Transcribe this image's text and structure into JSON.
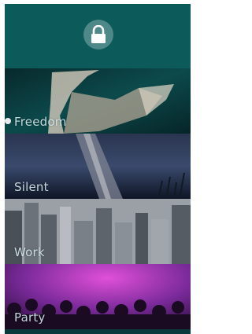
{
  "lock_screen": {
    "lock_icon": "lock-icon"
  },
  "ambiences": [
    {
      "label": "Freedom"
    },
    {
      "label": "Silent"
    },
    {
      "label": "Work"
    },
    {
      "label": "Party"
    }
  ],
  "colors": {
    "top_bar": "#0c5a5a",
    "freedom_bg": "#0a3a3e",
    "silent_bg": "#1a2a48",
    "work_bg": "#8a8f96",
    "party_bg": "#5a1a6a"
  }
}
